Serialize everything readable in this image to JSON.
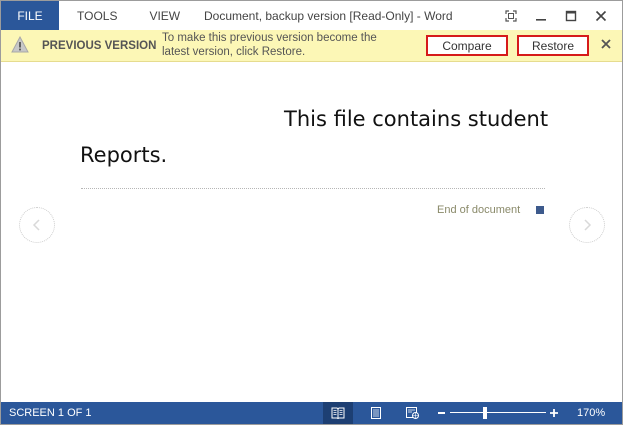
{
  "titlebar": {
    "menu": [
      {
        "label": "FILE"
      },
      {
        "label": "TOOLS"
      },
      {
        "label": "VIEW"
      }
    ],
    "title": "Document, backup version [Read-Only] - Word"
  },
  "infobar": {
    "label": "PREVIOUS VERSION",
    "message": "To make this previous version become the latest version, click Restore.",
    "compare_label": "Compare",
    "restore_label": "Restore",
    "highlight_color": "#d61a1a"
  },
  "document": {
    "line1": "This file contains student",
    "line2": "Reports.",
    "end_label": "End of document"
  },
  "statusbar": {
    "screen_label": "SCREEN 1 OF 1",
    "zoom_level": "170%",
    "zoom_fraction": 0.36
  },
  "colors": {
    "accent": "#2b579a",
    "infobar_bg": "#fcf7b6"
  }
}
